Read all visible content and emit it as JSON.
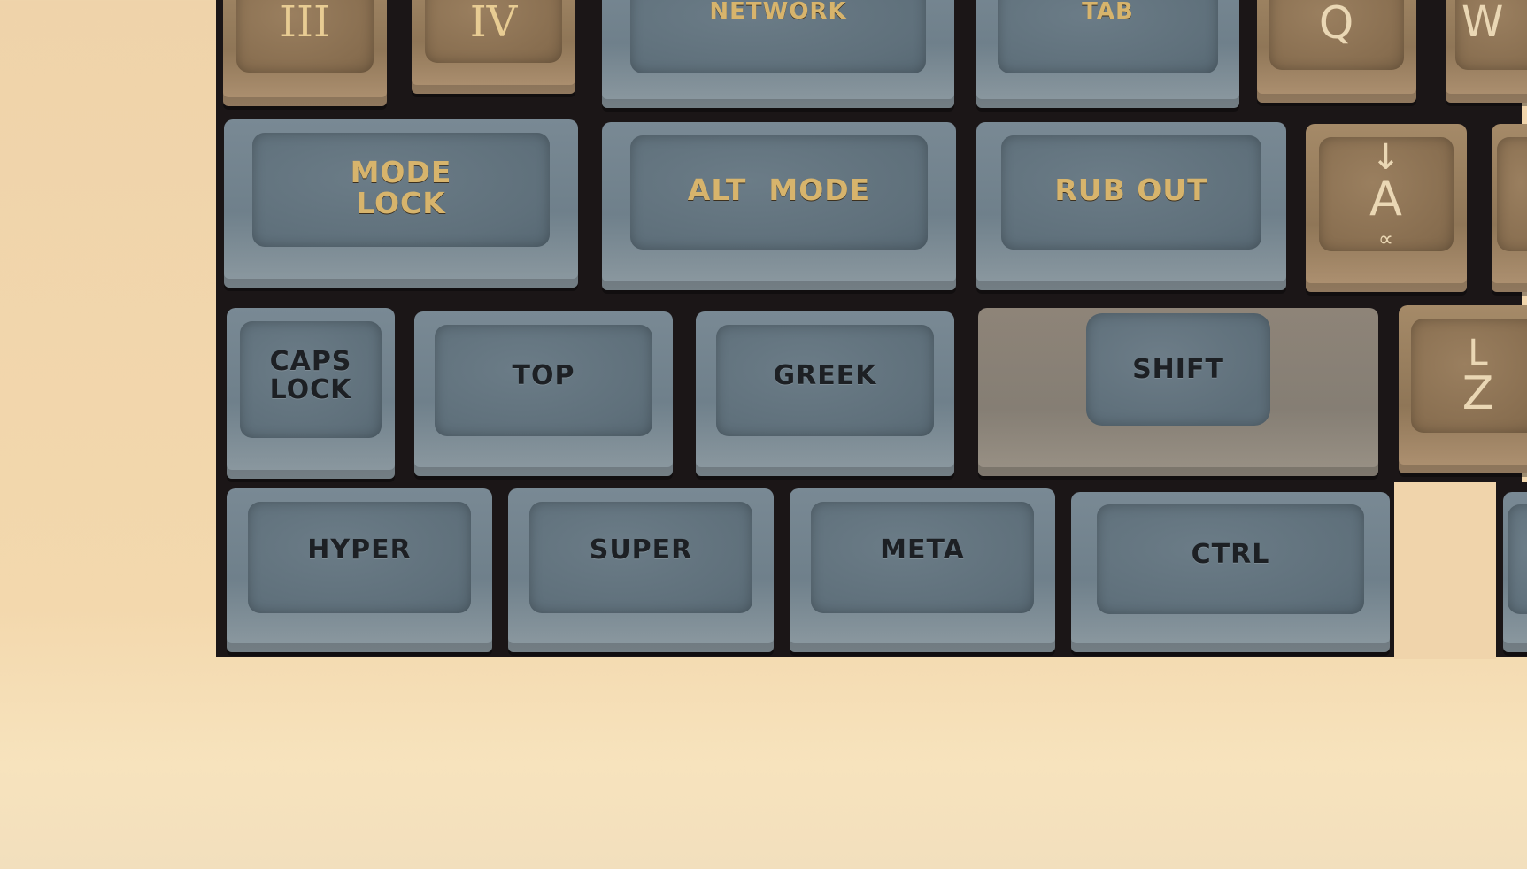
{
  "scene": "Close-up photograph of the lower-left corner of a vintage Lisp Machine style keyboard",
  "colors": {
    "case": "#f0d4ab",
    "tray": "#1b1617",
    "modifier_key": "#6f808b",
    "letter_key": "#8f7657",
    "legend_gold": "#d7b46c",
    "legend_dark": "#1d2024"
  },
  "rows": {
    "top": {
      "keys": [
        {
          "label": "III",
          "color": "tan"
        },
        {
          "label": "IV",
          "color": "tan"
        },
        {
          "label": "NETWORK",
          "color": "gray"
        },
        {
          "label": "TAB",
          "color": "gray"
        },
        {
          "label": "Q",
          "color": "tan"
        },
        {
          "label": "W",
          "color": "tan"
        }
      ]
    },
    "second": {
      "keys": [
        {
          "label": "MODE\nLOCK",
          "color": "gray"
        },
        {
          "label": "ALT  MODE",
          "color": "gray"
        },
        {
          "label": "RUB OUT",
          "color": "gray"
        },
        {
          "label": "A",
          "upper": "↓",
          "lower": "∝",
          "color": "tan"
        }
      ]
    },
    "third": {
      "keys": [
        {
          "label": "CAPS\nLOCK",
          "color": "gray"
        },
        {
          "label": "TOP",
          "color": "gray"
        },
        {
          "label": "GREEK",
          "color": "gray"
        },
        {
          "label": "SHIFT",
          "color": "gray"
        },
        {
          "label": "Z",
          "upper": "L",
          "color": "tan"
        }
      ]
    },
    "bottom": {
      "keys": [
        {
          "label": "HYPER",
          "color": "gray"
        },
        {
          "label": "SUPER",
          "color": "gray"
        },
        {
          "label": "META",
          "color": "gray"
        },
        {
          "label": "CTRL",
          "color": "gray"
        }
      ]
    }
  }
}
